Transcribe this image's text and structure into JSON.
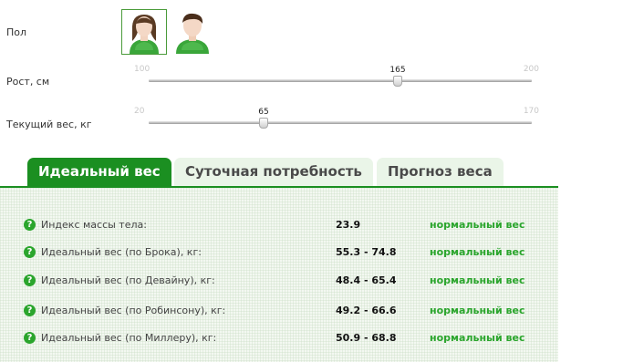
{
  "gender": {
    "label": "Пол",
    "options": [
      {
        "name": "female",
        "icon": "female-avatar-icon",
        "selected": true
      },
      {
        "name": "male",
        "icon": "male-avatar-icon",
        "selected": false
      }
    ]
  },
  "height": {
    "label": "Рост, см",
    "min": 100,
    "max": 200,
    "value": 165,
    "min_text": "100",
    "max_text": "200",
    "value_text": "165"
  },
  "weight": {
    "label": "Текущий вес, кг",
    "min": 20,
    "max": 170,
    "value": 65,
    "min_text": "20",
    "max_text": "170",
    "value_text": "65"
  },
  "tabs": [
    {
      "label": "Идеальный вес",
      "active": true
    },
    {
      "label": "Суточная потребность",
      "active": false
    },
    {
      "label": "Прогноз веса",
      "active": false
    }
  ],
  "results": [
    {
      "label": "Индекс массы тела:",
      "value": "23.9",
      "status": "нормальный вес"
    },
    {
      "label": "Идеальный вес (по Брока), кг:",
      "value": "55.3 - 74.8",
      "status": "нормальный вес"
    },
    {
      "label": "Идеальный вес (по Девайну), кг:",
      "value": "48.4 - 65.4",
      "status": "нормальный вес"
    },
    {
      "label": "Идеальный вес (по Робинсону), кг:",
      "value": "49.2 - 66.6",
      "status": "нормальный вес"
    },
    {
      "label": "Идеальный вес (по Миллеру), кг:",
      "value": "50.9 - 68.8",
      "status": "нормальный вес"
    }
  ],
  "help_glyph": "?",
  "colors": {
    "accent": "#1b8f21",
    "status": "#2aa52c"
  }
}
